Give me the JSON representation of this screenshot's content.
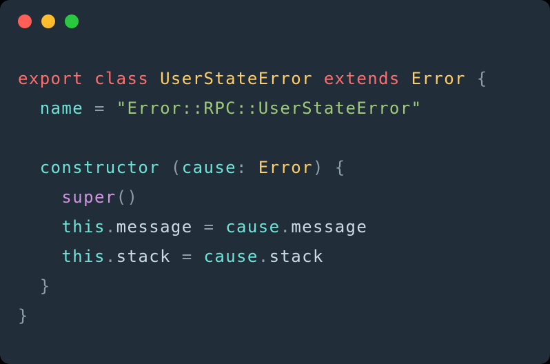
{
  "colors": {
    "background": "#212d38",
    "text": "#cadbe8",
    "keyword_red": "#ff6e6d",
    "type_yellow": "#fdce6a",
    "ident_teal": "#6ee3d8",
    "string_green": "#9fca7a",
    "keyword_purple": "#d292e2",
    "punctuation": "#8d9eac",
    "dot_red": "#ff5f56",
    "dot_yellow": "#ffbd2d",
    "dot_green": "#28c93f"
  },
  "titlebar": {
    "dots": [
      "red",
      "yellow",
      "green"
    ]
  },
  "code": {
    "language": "typescript",
    "lines": [
      [
        {
          "cls": "kw-red",
          "t": "export"
        },
        {
          "cls": "",
          "t": " "
        },
        {
          "cls": "kw-red",
          "t": "class"
        },
        {
          "cls": "",
          "t": " "
        },
        {
          "cls": "type",
          "t": "UserStateError"
        },
        {
          "cls": "",
          "t": " "
        },
        {
          "cls": "kw-red",
          "t": "extends"
        },
        {
          "cls": "",
          "t": " "
        },
        {
          "cls": "type",
          "t": "Error"
        },
        {
          "cls": "",
          "t": " "
        },
        {
          "cls": "punct",
          "t": "{"
        }
      ],
      [
        {
          "cls": "",
          "t": "  "
        },
        {
          "cls": "ident",
          "t": "name"
        },
        {
          "cls": "",
          "t": " "
        },
        {
          "cls": "punct",
          "t": "="
        },
        {
          "cls": "",
          "t": " "
        },
        {
          "cls": "str",
          "t": "\"Error::RPC::UserStateError\""
        }
      ],
      [],
      [
        {
          "cls": "",
          "t": "  "
        },
        {
          "cls": "ident",
          "t": "constructor"
        },
        {
          "cls": "",
          "t": " "
        },
        {
          "cls": "punct",
          "t": "("
        },
        {
          "cls": "ident",
          "t": "cause"
        },
        {
          "cls": "punct",
          "t": ":"
        },
        {
          "cls": "",
          "t": " "
        },
        {
          "cls": "type",
          "t": "Error"
        },
        {
          "cls": "punct",
          "t": ")"
        },
        {
          "cls": "",
          "t": " "
        },
        {
          "cls": "punct",
          "t": "{"
        }
      ],
      [
        {
          "cls": "",
          "t": "    "
        },
        {
          "cls": "kw-super",
          "t": "super"
        },
        {
          "cls": "punct",
          "t": "()"
        }
      ],
      [
        {
          "cls": "",
          "t": "    "
        },
        {
          "cls": "ident",
          "t": "this"
        },
        {
          "cls": "punct",
          "t": "."
        },
        {
          "cls": "prop",
          "t": "message"
        },
        {
          "cls": "",
          "t": " "
        },
        {
          "cls": "punct",
          "t": "="
        },
        {
          "cls": "",
          "t": " "
        },
        {
          "cls": "ident",
          "t": "cause"
        },
        {
          "cls": "punct",
          "t": "."
        },
        {
          "cls": "prop",
          "t": "message"
        }
      ],
      [
        {
          "cls": "",
          "t": "    "
        },
        {
          "cls": "ident",
          "t": "this"
        },
        {
          "cls": "punct",
          "t": "."
        },
        {
          "cls": "prop",
          "t": "stack"
        },
        {
          "cls": "",
          "t": " "
        },
        {
          "cls": "punct",
          "t": "="
        },
        {
          "cls": "",
          "t": " "
        },
        {
          "cls": "ident",
          "t": "cause"
        },
        {
          "cls": "punct",
          "t": "."
        },
        {
          "cls": "prop",
          "t": "stack"
        }
      ],
      [
        {
          "cls": "",
          "t": "  "
        },
        {
          "cls": "punct",
          "t": "}"
        }
      ],
      [
        {
          "cls": "punct",
          "t": "}"
        }
      ]
    ]
  }
}
